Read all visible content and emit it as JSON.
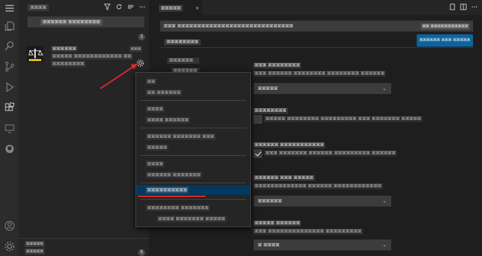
{
  "sidebar": {
    "title": "ꕤꕤꕤꕤ",
    "search_value": "ꕤꕤꕤꕤꕤꕤ ꕤꕤꕤꕤꕤꕤꕤꕤ",
    "section_count": "1",
    "extension": {
      "name": "ꕤꕤꕤꕤꕤꕤ",
      "version": "ꕤꕤꕤ",
      "description": "ꕤꕤꕤꕤꕤ ꕤꕤꕤꕤꕤꕤꕤꕤꕤꕤꕤꕤ ꕤꕤ",
      "publisher": "ꕤꕤꕤꕤꕤꕤꕤꕤ"
    },
    "bottom_label": "ꕤꕤꕤꕤꕤ",
    "bottom_label2": "ꕤꕤꕤꕤꕤ",
    "bottom_count": "5"
  },
  "editor": {
    "tab_label": "ꕤꕤꕤꕤꕤ",
    "tab_close": "×",
    "search_value": "ꕤꕤꕤ ꕤꕤꕤꕤꕤꕤꕤꕤꕤꕤꕤꕤꕤꕤꕤꕤꕤꕤꕤꕤꕤꕤꕤꕤꕤꕤꕤꕤꕤ",
    "search_right": "ꕤꕤ ꕤꕤꕤꕤꕤꕤꕤꕤꕤꕤꕤ",
    "settings_tab": "ꕤꕤꕤꕤꕤꕤꕤꕤ",
    "backup_button": "ꕤꕤꕤꕤꕤꕤ ꕤꕤꕤ ꕤꕤꕤꕤꕤ",
    "toc_item1": "ꕤꕤꕤꕤꕤꕤ",
    "toc_item2": "ꕤꕤꕤꕤꕤꕤ",
    "settings": [
      {
        "title": "ꕤꕤꕤ ꕤꕤꕤꕤꕤꕤꕤꕤ",
        "desc": "ꕤꕤꕤ ꕤꕤꕤꕤꕤꕤ ꕤꕤꕤꕤꕤꕤꕤꕤ ꕤꕤꕤꕤꕤꕤꕤꕤ ꕤꕤꕤꕤꕤꕤ",
        "dropdown": "ꕤꕤꕤꕤꕤ"
      },
      {
        "title": "ꕤꕤꕤꕤꕤꕤꕤꕤ",
        "desc": "ꕤꕤꕤꕤꕤ ꕤꕤꕤꕤꕤꕤꕤꕤ ꕤꕤꕤꕤꕤꕤꕤꕤꕤ ꕤꕤꕤ ꕤꕤꕤꕤꕤꕤꕤ ꕤꕤꕤꕤꕤ"
      },
      {
        "title": "ꕤꕤꕤꕤꕤꕤ ꕤꕤꕤꕤꕤꕤꕤꕤꕤꕤꕤ",
        "desc": "ꕤꕤꕤ ꕤꕤꕤꕤꕤꕤꕤ ꕤꕤꕤꕤꕤꕤ ꕤꕤꕤꕤꕤꕤꕤꕤꕤ ꕤꕤꕤꕤꕤꕤ"
      },
      {
        "title": "ꕤꕤꕤꕤꕤꕤ ꕤꕤꕤ ꕤꕤꕤꕤꕤ",
        "desc": "ꕤꕤꕤꕤꕤꕤꕤꕤꕤꕤꕤꕤꕤ ꕤꕤꕤꕤꕤꕤ ꕤꕤꕤꕤꕤꕤꕤꕤꕤꕤꕤꕤ",
        "dropdown": "ꕤꕤꕤꕤꕤꕤ"
      },
      {
        "title": "ꕤꕤꕤꕤꕤ ꕤꕤꕤꕤꕤꕤ",
        "desc": "ꕤꕤꕤ ꕤꕤꕤꕤꕤꕤꕤꕤꕤꕤꕤꕤꕤꕤ ꕤꕤꕤꕤꕤꕤꕤꕤꕤ",
        "dropdown": "ꕤ ꕤꕤꕤꕤ"
      }
    ]
  },
  "context_menu": {
    "items": [
      "ꕤꕤ",
      "ꕤꕤ ꕤꕤꕤꕤꕤꕤ",
      "ꕤꕤꕤꕤ",
      "ꕤꕤꕤꕤ ꕤꕤꕤꕤꕤꕤ",
      "ꕤꕤꕤꕤꕤꕤ ꕤꕤꕤꕤꕤꕤꕤ ꕤꕤꕤ",
      "ꕤꕤꕤꕤꕤ",
      "ꕤꕤꕤꕤ",
      "ꕤꕤꕤꕤꕤꕤ ꕤꕤꕤꕤꕤꕤꕤ",
      "ꕤꕤꕤꕤꕤꕤꕤꕤꕤꕤ",
      "ꕤꕤꕤꕤꕤꕤꕤꕤ ꕤꕤꕤꕤꕤꕤꕤ",
      "ꕤꕤꕤꕤ ꕤꕤꕤꕤꕤꕤꕤ ꕤꕤꕤꕤꕤ"
    ],
    "highlighted_index": 8
  },
  "colors": {
    "accent": "#0e639c",
    "highlight": "#04395e",
    "annotation": "#e0282a"
  }
}
